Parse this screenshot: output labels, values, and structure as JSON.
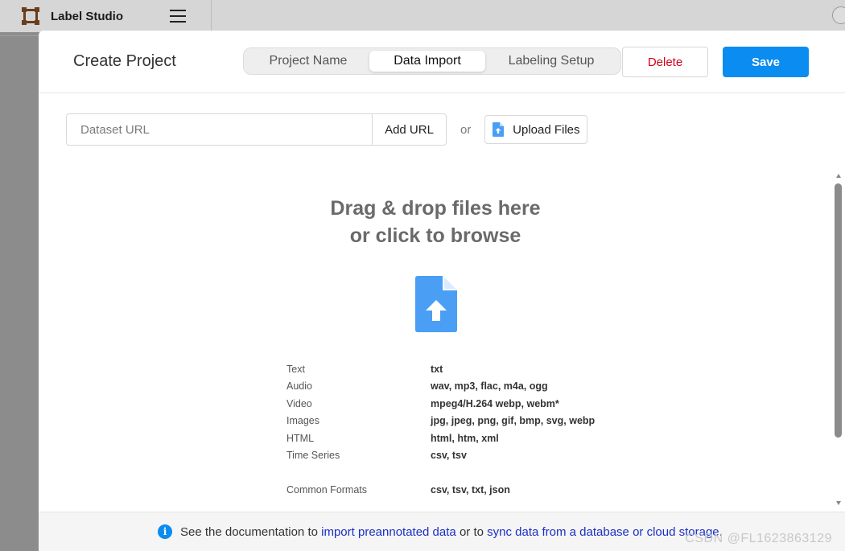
{
  "app": {
    "name": "Label Studio"
  },
  "modal": {
    "title": "Create Project",
    "tabs": [
      {
        "label": "Project Name"
      },
      {
        "label": "Data Import",
        "active": true
      },
      {
        "label": "Labeling Setup"
      }
    ],
    "delete_label": "Delete",
    "save_label": "Save"
  },
  "import": {
    "url_placeholder": "Dataset URL",
    "url_value": "",
    "add_url_label": "Add URL",
    "or_text": "or",
    "upload_label": "Upload Files",
    "drop_line1": "Drag & drop files here",
    "drop_line2": "or click to browse",
    "formats": [
      {
        "type": "Text",
        "ext": "txt"
      },
      {
        "type": "Audio",
        "ext": "wav, mp3, flac, m4a, ogg"
      },
      {
        "type": "Video",
        "ext": "mpeg4/H.264 webp, webm*"
      },
      {
        "type": "Images",
        "ext": "jpg, jpeg, png, gif, bmp, svg, webp"
      },
      {
        "type": "HTML",
        "ext": "html, htm, xml"
      },
      {
        "type": "Time Series",
        "ext": "csv, tsv"
      },
      {
        "type": "Common Formats",
        "ext": "csv, tsv, txt, json"
      }
    ]
  },
  "footer": {
    "text1": "See the documentation to ",
    "link1": "import preannotated data",
    "text2": " or to ",
    "link2": "sync data from a database or cloud storage",
    "text3": ".",
    "watermark": "CSDN @FL1623863129"
  },
  "colors": {
    "primary": "#0a8cf0",
    "danger": "#d0021b",
    "link": "#1a2fc7"
  }
}
